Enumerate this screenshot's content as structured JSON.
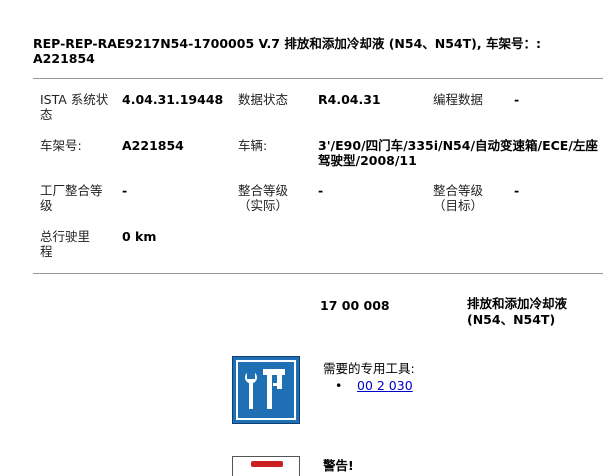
{
  "header": {
    "title": "REP-REP-RAE9217N54-1700005   V.7   排放和添加冷却液  (N54、N54T), 车架号：: A221854"
  },
  "info": {
    "ista_label": "ISTA 系统状态",
    "ista_value": "4.04.31.19448",
    "data_status_label": "数据状态",
    "data_status_value": "R4.04.31",
    "programming_label": "编程数据",
    "programming_value": "-",
    "vin_label": "车架号:",
    "vin_value": "A221854",
    "vehicle_label": "车辆:",
    "vehicle_value": "3'/E90/四门车/335i/N54/自动变速箱/ECE/左座驾驶型/2008/11",
    "factory_level_label": "工厂整合等级",
    "factory_level_value": "-",
    "actual_level_label": "整合等级（实际）",
    "actual_level_value": "-",
    "target_level_label": "整合等级（目标）",
    "target_level_value": "-",
    "mileage_label": "总行驶里程",
    "mileage_value": "0 km"
  },
  "operation": {
    "code": "17 00 008",
    "name": "排放和添加冷却液 (N54、N54T)"
  },
  "tools": {
    "heading": "需要的专用工具:",
    "bullet": "•",
    "items": [
      "00 2 030"
    ]
  },
  "warning": {
    "heading": "警告!"
  },
  "colors": {
    "tool_icon_bg": "#1f6fb5",
    "link": "#0000cc",
    "warning_red": "#cc1f1f"
  }
}
